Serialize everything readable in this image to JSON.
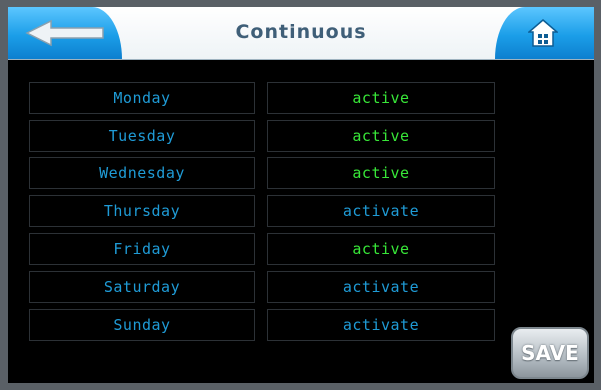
{
  "header": {
    "title": "Continuous",
    "back_icon": "arrow-left-icon",
    "home_icon": "home-icon"
  },
  "schedule": [
    {
      "day": "Monday",
      "status": "active"
    },
    {
      "day": "Tuesday",
      "status": "active"
    },
    {
      "day": "Wednesday",
      "status": "active"
    },
    {
      "day": "Thursday",
      "status": "activate"
    },
    {
      "day": "Friday",
      "status": "active"
    },
    {
      "day": "Saturday",
      "status": "activate"
    },
    {
      "day": "Sunday",
      "status": "activate"
    }
  ],
  "footer": {
    "save_label": "SAVE"
  },
  "colors": {
    "active": "#38e638",
    "inactive": "#1f9bd6",
    "button_blue": "#1b9ee8"
  }
}
